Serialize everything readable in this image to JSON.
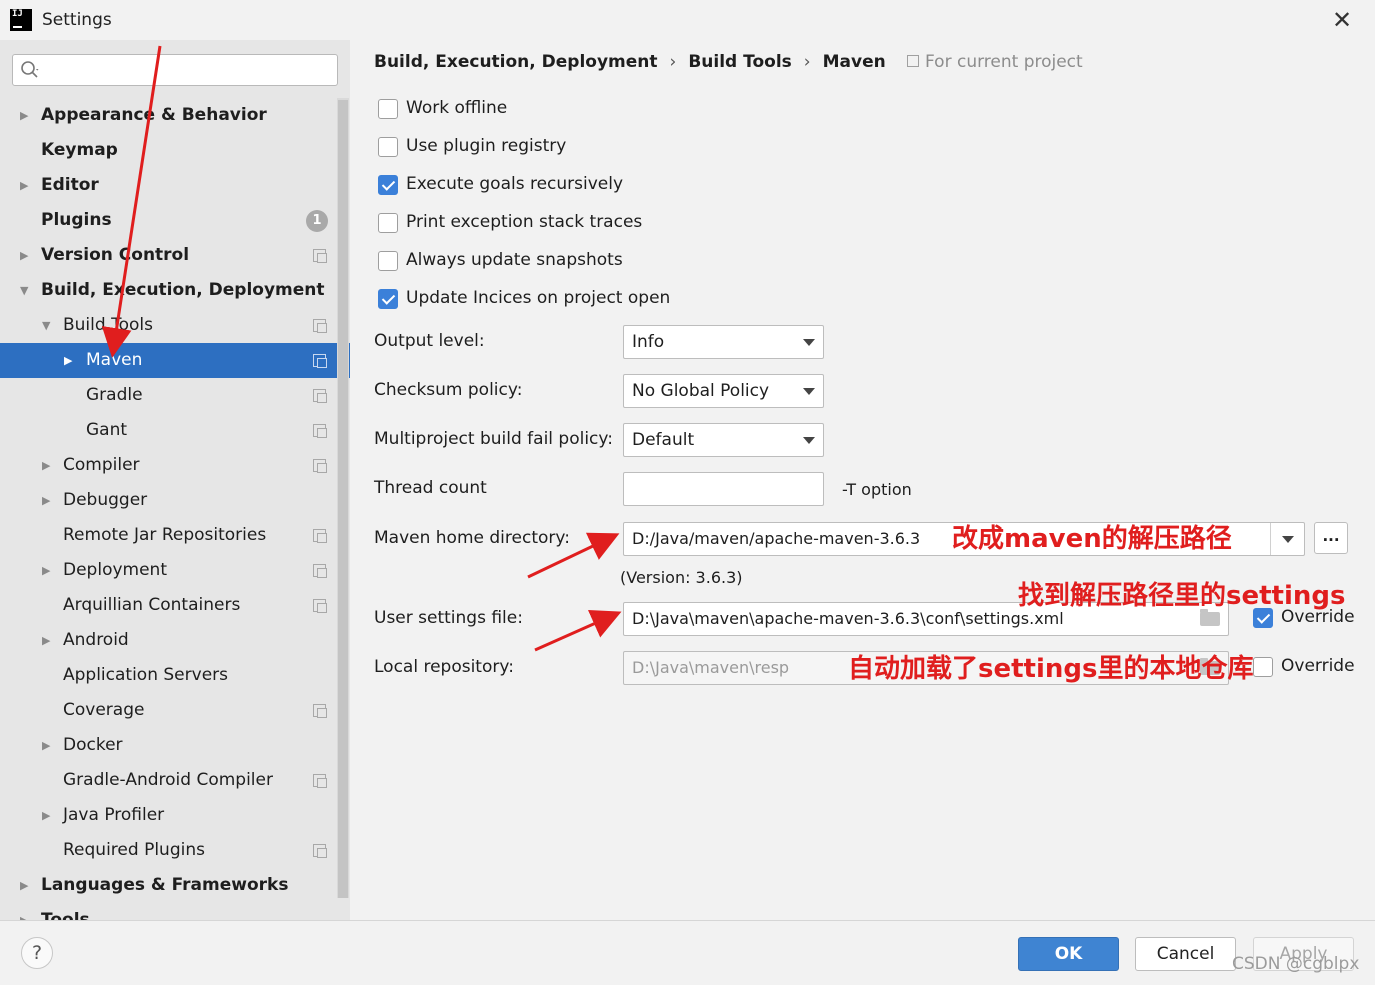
{
  "window": {
    "title": "Settings",
    "close_symbol": "✕",
    "logo_text": "IJ"
  },
  "sidebar": {
    "search_placeholder": "",
    "plugins_badge": "1",
    "items": [
      {
        "label": "Appearance & Behavior",
        "bold": true,
        "expandable": true,
        "expanded": false,
        "level": 0,
        "proj": false
      },
      {
        "label": "Keymap",
        "bold": true,
        "expandable": false,
        "level": 0,
        "proj": false
      },
      {
        "label": "Editor",
        "bold": true,
        "expandable": true,
        "expanded": false,
        "level": 0,
        "proj": false
      },
      {
        "label": "Plugins",
        "bold": true,
        "expandable": false,
        "level": 0,
        "proj": false,
        "badge": true
      },
      {
        "label": "Version Control",
        "bold": true,
        "expandable": true,
        "expanded": false,
        "level": 0,
        "proj": true
      },
      {
        "label": "Build, Execution, Deployment",
        "bold": true,
        "expandable": true,
        "expanded": true,
        "level": 0,
        "proj": false
      },
      {
        "label": "Build Tools",
        "bold": false,
        "expandable": true,
        "expanded": true,
        "level": 1,
        "proj": true
      },
      {
        "label": "Maven",
        "bold": false,
        "expandable": true,
        "expanded": false,
        "level": 2,
        "proj": true,
        "selected": true
      },
      {
        "label": "Gradle",
        "bold": false,
        "expandable": false,
        "level": 2,
        "proj": true
      },
      {
        "label": "Gant",
        "bold": false,
        "expandable": false,
        "level": 2,
        "proj": true
      },
      {
        "label": "Compiler",
        "bold": false,
        "expandable": true,
        "expanded": false,
        "level": 1,
        "proj": true
      },
      {
        "label": "Debugger",
        "bold": false,
        "expandable": true,
        "expanded": false,
        "level": 1,
        "proj": false
      },
      {
        "label": "Remote Jar Repositories",
        "bold": false,
        "expandable": false,
        "level": 1,
        "proj": true
      },
      {
        "label": "Deployment",
        "bold": false,
        "expandable": true,
        "expanded": false,
        "level": 1,
        "proj": true
      },
      {
        "label": "Arquillian Containers",
        "bold": false,
        "expandable": false,
        "level": 1,
        "proj": true
      },
      {
        "label": "Android",
        "bold": false,
        "expandable": true,
        "expanded": false,
        "level": 1,
        "proj": false
      },
      {
        "label": "Application Servers",
        "bold": false,
        "expandable": false,
        "level": 1,
        "proj": false
      },
      {
        "label": "Coverage",
        "bold": false,
        "expandable": false,
        "level": 1,
        "proj": true
      },
      {
        "label": "Docker",
        "bold": false,
        "expandable": true,
        "expanded": false,
        "level": 1,
        "proj": false
      },
      {
        "label": "Gradle-Android Compiler",
        "bold": false,
        "expandable": false,
        "level": 1,
        "proj": true
      },
      {
        "label": "Java Profiler",
        "bold": false,
        "expandable": true,
        "expanded": false,
        "level": 1,
        "proj": false
      },
      {
        "label": "Required Plugins",
        "bold": false,
        "expandable": false,
        "level": 1,
        "proj": true
      },
      {
        "label": "Languages & Frameworks",
        "bold": true,
        "expandable": true,
        "expanded": false,
        "level": 0,
        "proj": false
      },
      {
        "label": "Tools",
        "bold": true,
        "expandable": true,
        "expanded": false,
        "level": 0,
        "proj": false
      }
    ]
  },
  "breadcrumb": {
    "parts": [
      "Build, Execution, Deployment",
      "Build Tools",
      "Maven"
    ],
    "separator": "›",
    "scope_label": "For current project"
  },
  "checkboxes": [
    {
      "label": "Work offline",
      "checked": false
    },
    {
      "label": "Use plugin registry",
      "checked": false
    },
    {
      "label": "Execute goals recursively",
      "checked": true
    },
    {
      "label": "Print exception stack traces",
      "checked": false
    },
    {
      "label": "Always update snapshots",
      "checked": false
    },
    {
      "label": "Update Incices on project open",
      "checked": true
    }
  ],
  "fields": {
    "output_level": {
      "label": "Output level:",
      "value": "Info"
    },
    "checksum_policy": {
      "label": "Checksum policy:",
      "value": "No Global Policy"
    },
    "fail_policy": {
      "label": "Multiproject build fail policy:",
      "value": "Default"
    },
    "thread_count": {
      "label": "Thread count",
      "value": "",
      "suffix": "-T option"
    },
    "maven_home": {
      "label": "Maven home directory:",
      "value": "D:/Java/maven/apache-maven-3.6.3",
      "browse": "..."
    },
    "version": "(Version: 3.6.3)",
    "user_settings": {
      "label": "User settings file:",
      "value": "D:\\Java\\maven\\apache-maven-3.6.3\\conf\\settings.xml",
      "override_label": "Override",
      "override_checked": true
    },
    "local_repo": {
      "label": "Local repository:",
      "value": "D:\\Java\\maven\\resp",
      "override_label": "Override",
      "override_checked": false
    }
  },
  "annotations": {
    "note1": "改成maven的解压路径",
    "note2": "找到解压路径里的settings",
    "note3": "自动加载了settings里的本地仓库",
    "color": "#e01e1e"
  },
  "footer": {
    "help": "?",
    "ok": "OK",
    "cancel": "Cancel",
    "apply": "Apply",
    "watermark": "CSDN @cgblpx"
  },
  "colors": {
    "selection": "#2d6fc1",
    "ok_button": "#3f84d2",
    "checkbox_on": "#3b80d9"
  }
}
